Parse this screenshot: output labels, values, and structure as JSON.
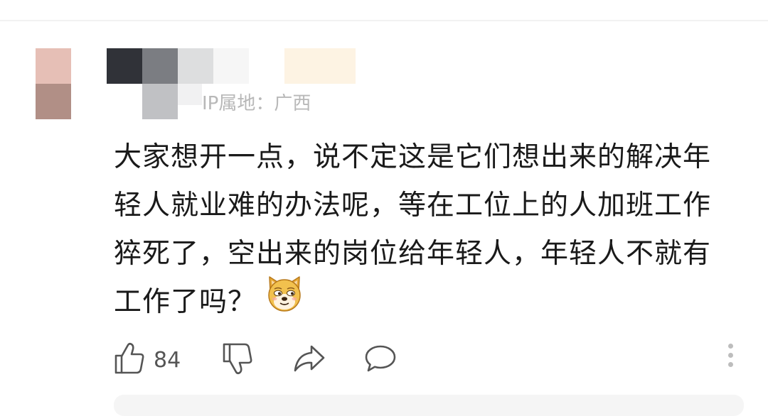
{
  "comment": {
    "location": "IP属地：广西",
    "text": "大家想开一点，说不定这是它们想出来的解决年轻人就业难的办法呢，等在工位上的人加班工作猝死了，空出来的岗位给年轻人，年轻人不就有工作了吗？",
    "emoji": "doge-emoji",
    "likes": "84"
  },
  "actions": {
    "like_icon": "thumbs-up-icon",
    "dislike_icon": "thumbs-down-icon",
    "share_icon": "share-icon",
    "reply_icon": "comment-icon",
    "more_icon": "more-vertical-icon"
  },
  "colors": {
    "text": "#1a1a1a",
    "meta": "#b8b8b8",
    "icon": "#555555"
  }
}
